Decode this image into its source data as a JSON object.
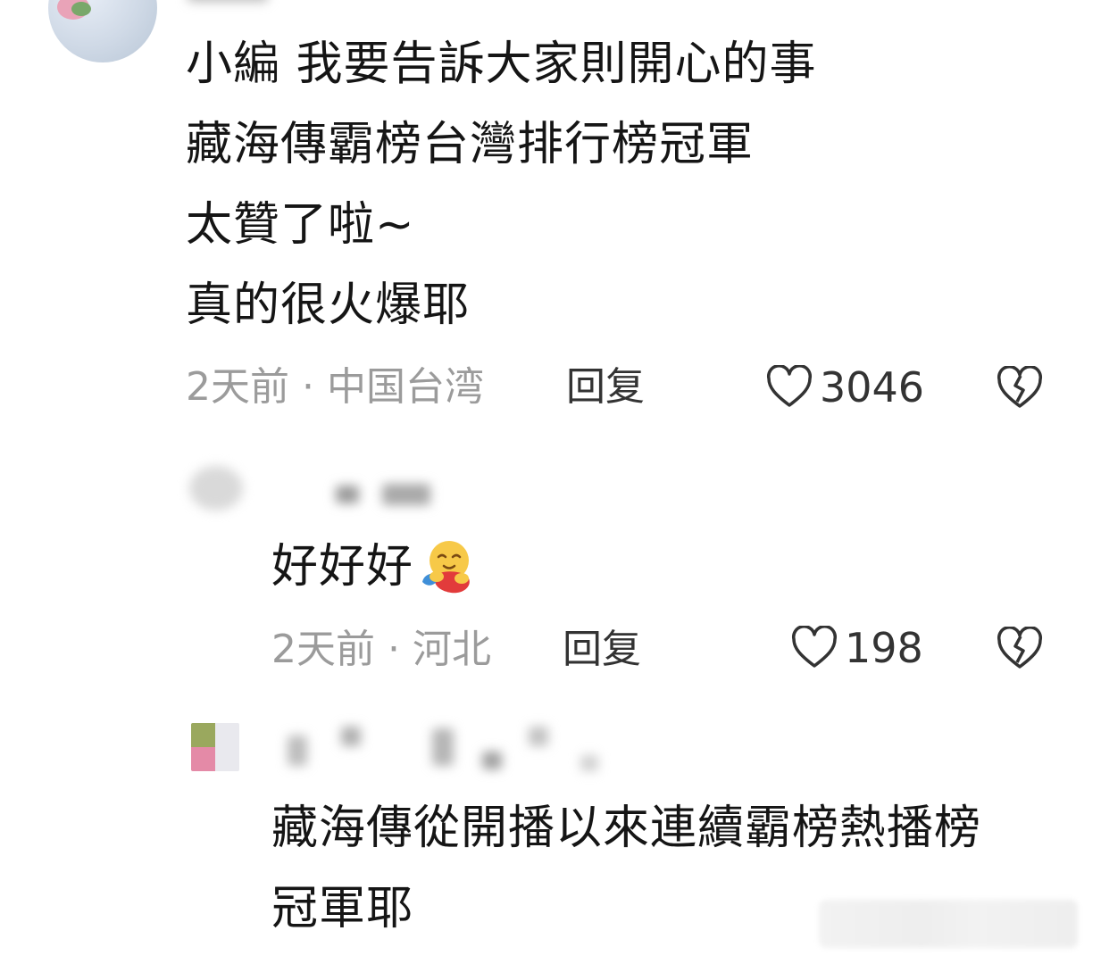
{
  "comments": [
    {
      "lines": [
        "小編 我要告訴大家則開心的事",
        "藏海傳霸榜台灣排行榜冠軍",
        "太贊了啦~",
        "真的很火爆耶"
      ],
      "meta": "2天前 · 中国台湾",
      "reply_label": "回复",
      "likes": "3046"
    },
    {
      "lines": [
        "好好好"
      ],
      "emoji": "hug-emoji",
      "meta": "2天前 · 河北",
      "reply_label": "回复",
      "likes": "198"
    },
    {
      "lines": [
        "藏海傳從開播以來連續霸榜熱播榜",
        "冠軍耶"
      ]
    }
  ],
  "icons": {
    "like": "heart-outline-icon",
    "dislike": "broken-heart-icon"
  },
  "colors": {
    "meta": "#9b9b9b",
    "text": "#151515",
    "icon": "#333333"
  }
}
